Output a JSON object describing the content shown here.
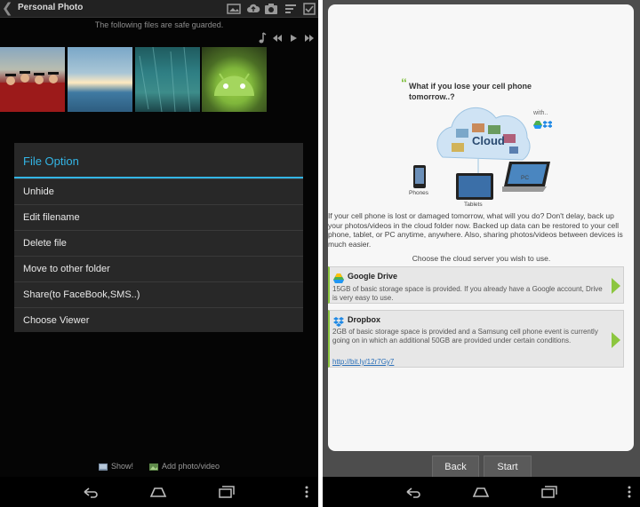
{
  "left": {
    "title": "Personal Photo",
    "subtitle": "The following files are safe guarded.",
    "dialog": {
      "title": "File Option",
      "items": [
        "Unhide",
        "Edit filename",
        "Delete file",
        "Move to other folder",
        "Share(to FaceBook,SMS..)",
        "Choose Viewer"
      ]
    },
    "bottom": {
      "show_label": "Show!",
      "add_label": "Add photo/video"
    }
  },
  "right": {
    "headline": "What if you lose your cell phone tomorrow..?",
    "cloud_label": "Cloud",
    "with_label": "with..",
    "devices": [
      "Phones",
      "Tablets",
      "PC"
    ],
    "description": "If your cell phone is lost or damaged tomorrow, what will you do? Don't delay, back up your photos/videos in the cloud folder now. Backed up data can be restored to your cell phone, tablet, or PC anytime, anywhere. Also, sharing photos/videos between devices is much easier.",
    "choose_text": "Choose the cloud server you wish to use.",
    "options": [
      {
        "title": "Google Drive",
        "desc": "15GB of basic storage space is provided. If you already have a Google account, Drive is very easy to use.",
        "link": ""
      },
      {
        "title": "Dropbox",
        "desc": "2GB of basic storage space is provided and a Samsung cell phone event is currently going on in which an additional 50GB are provided under certain conditions.",
        "link": "http://bit.ly/12r7Gy7"
      }
    ],
    "back_label": "Back",
    "start_label": "Start"
  },
  "colors": {
    "accent_blue": "#33b5e5",
    "accent_green": "#8cc63f",
    "link": "#2a6fb8"
  }
}
